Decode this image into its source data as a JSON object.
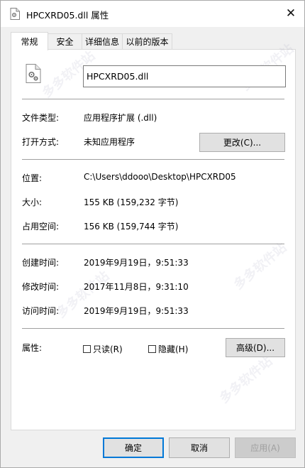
{
  "window": {
    "title": "HPCXRD05.dll 属性",
    "close_symbol": "✕"
  },
  "tabs": [
    {
      "label": "常规",
      "active": true
    },
    {
      "label": "安全",
      "active": false
    },
    {
      "label": "详细信息",
      "active": false
    },
    {
      "label": "以前的版本",
      "active": false
    }
  ],
  "general": {
    "file_name": "HPCXRD05.dll",
    "file_type_label": "文件类型:",
    "file_type_value": "应用程序扩展 (.dll)",
    "opens_with_label": "打开方式:",
    "opens_with_value": "未知应用程序",
    "change_button": "更改(C)...",
    "location_label": "位置:",
    "location_value": "C:\\Users\\ddooo\\Desktop\\HPCXRD05",
    "size_label": "大小:",
    "size_value": "155 KB (159,232 字节)",
    "size_on_disk_label": "占用空间:",
    "size_on_disk_value": "156 KB (159,744 字节)",
    "created_label": "创建时间:",
    "created_value": "2019年9月19日，9:51:33",
    "modified_label": "修改时间:",
    "modified_value": "2017年11月8日，9:31:10",
    "accessed_label": "访问时间:",
    "accessed_value": "2019年9月19日，9:51:33",
    "attributes_label": "属性:",
    "readonly_label": "只读(R)",
    "readonly_checked": false,
    "hidden_label": "隐藏(H)",
    "hidden_checked": false,
    "advanced_button": "高级(D)..."
  },
  "footer": {
    "ok_button": "确定",
    "cancel_button": "取消",
    "apply_button": "应用(A)"
  },
  "watermark_text": "多多软件站",
  "colors": {
    "accent": "#0078d7",
    "window_bg": "#f0f0f0",
    "panel_bg": "#ffffff"
  },
  "icons": {
    "title_icon": "dll-file-icon",
    "file_icon": "dll-file-gear-icon",
    "close_icon": "close-icon"
  }
}
